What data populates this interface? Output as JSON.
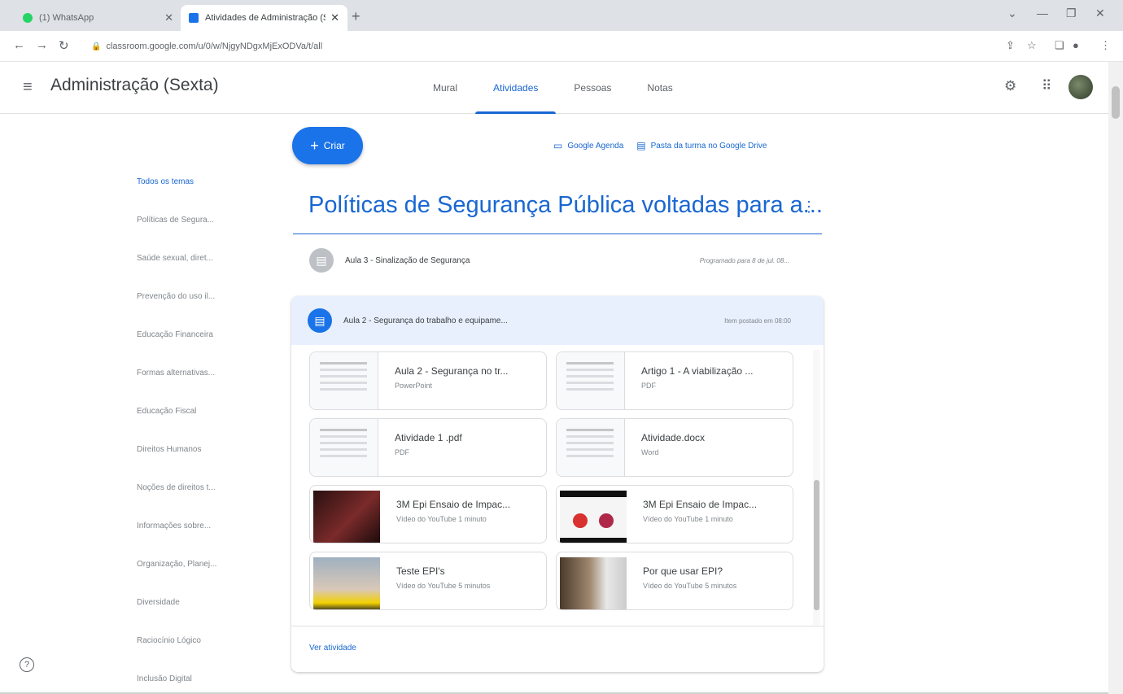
{
  "browser": {
    "tabs": [
      {
        "label": "(1) WhatsApp"
      },
      {
        "label": "Atividades de Administração (Se..."
      }
    ],
    "url": "classroom.google.com/u/0/w/NjgyNDgxMjExODVa/t/all"
  },
  "header": {
    "class_name": "Administração (Sexta)",
    "tabs": [
      {
        "label": "Mural"
      },
      {
        "label": "Atividades"
      },
      {
        "label": "Pessoas"
      },
      {
        "label": "Notas"
      }
    ]
  },
  "sidebar": {
    "topics": [
      {
        "label": "Todos os temas"
      },
      {
        "label": "Políticas de Segura..."
      },
      {
        "label": "Saúde sexual, diret..."
      },
      {
        "label": "Prevenção do uso il..."
      },
      {
        "label": "Educação Financeira"
      },
      {
        "label": "Formas alternativas..."
      },
      {
        "label": "Educação Fiscal"
      },
      {
        "label": "Direitos Humanos"
      },
      {
        "label": "Noções de direitos t..."
      },
      {
        "label": "Informações sobre..."
      },
      {
        "label": "Organização, Planej..."
      },
      {
        "label": "Diversidade"
      },
      {
        "label": "Raciocínio Lógico"
      },
      {
        "label": "Inclusão Digital"
      }
    ]
  },
  "main": {
    "create_label": "Criar",
    "calendar_link": "Google Agenda",
    "drive_link": "Pasta da turma no Google Drive",
    "topic_title": "Políticas de Segurança Pública voltadas para a...",
    "assignments": [
      {
        "title": "Aula 3 - Sinalização de Segurança",
        "date": "Programado para 8 de jul. 08..."
      },
      {
        "title": "Aula 2 - Segurança do trabalho e equipame...",
        "date": "Item postado em 08:00"
      }
    ],
    "materials": [
      {
        "title": "Aula 2 - Segurança no tr...",
        "sub": "PowerPoint"
      },
      {
        "title": "Artigo 1 - A viabilização ...",
        "sub": "PDF"
      },
      {
        "title": "Atividade 1 .pdf",
        "sub": "PDF"
      },
      {
        "title": "Atividade.docx",
        "sub": "Word"
      },
      {
        "title": "3M Epi Ensaio de Impac...",
        "sub": "Vídeo do YouTube   1 minuto"
      },
      {
        "title": "3M Epi Ensaio de Impac...",
        "sub": "Vídeo do YouTube   1 minuto"
      },
      {
        "title": "Teste EPI's",
        "sub": "Vídeo do YouTube   5 minutos"
      },
      {
        "title": "Por que usar EPI?",
        "sub": "Vídeo do YouTube   5 minutos"
      }
    ],
    "view_link": "Ver atividade"
  },
  "colors": {
    "accent": "#1967d2",
    "create_button": "#1a73e8",
    "expanded_header": "#e8f0fe"
  },
  "icons": [
    "menu-icon",
    "settings-icon",
    "apps-grid-icon",
    "calendar-icon",
    "drive-folder-icon",
    "assignment-icon",
    "more-vert-icon",
    "help-icon"
  ]
}
